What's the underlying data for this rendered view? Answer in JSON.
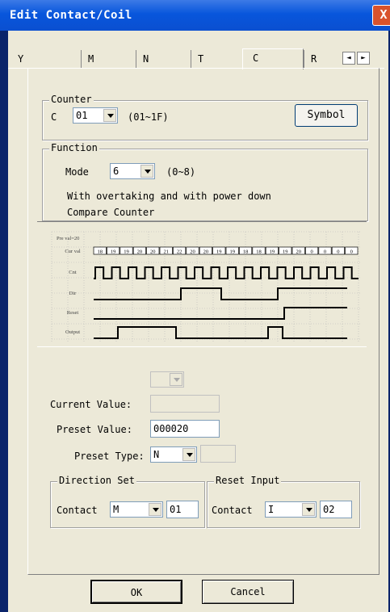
{
  "window": {
    "title": "Edit Contact/Coil",
    "close": "X"
  },
  "tabs": [
    "Y",
    "M",
    "N",
    "T",
    "C",
    "R"
  ],
  "tab_arrows": {
    "left": "◄",
    "right": "►"
  },
  "counter": {
    "legend": "Counter",
    "label": "C",
    "value": "01",
    "range": "(01~1F)",
    "symbol_button": "Symbol"
  },
  "function": {
    "legend": "Function",
    "mode_label": "Mode",
    "mode_value": "6",
    "mode_range": "(0~8)",
    "desc_line1": "With overtaking and with power down",
    "desc_line2": "Compare Counter"
  },
  "timing": {
    "preval": "Pre val=20",
    "rows": [
      "Cur val",
      "Cnt",
      "Dir",
      "Reset",
      "Output"
    ],
    "cur_vals": [
      "18",
      "19",
      "19",
      "20",
      "20",
      "21",
      "22",
      "20",
      "20",
      "19",
      "19",
      "18",
      "18",
      "19",
      "19",
      "20",
      "0",
      "0",
      "0",
      "0"
    ]
  },
  "values": {
    "current_value_label": "Current Value:",
    "current_value": "",
    "preset_value_label": "Preset Value:",
    "preset_value": "000020",
    "preset_type_label": "Preset Type:",
    "preset_type": "N",
    "preset_extra": ""
  },
  "direction": {
    "legend": "Direction Set",
    "contact_label": "Contact",
    "contact_type": "M",
    "contact_num": "01"
  },
  "reset": {
    "legend": "Reset Input",
    "contact_label": "Contact",
    "contact_type": "I",
    "contact_num": "02"
  },
  "buttons": {
    "ok": "OK",
    "cancel": "Cancel"
  }
}
